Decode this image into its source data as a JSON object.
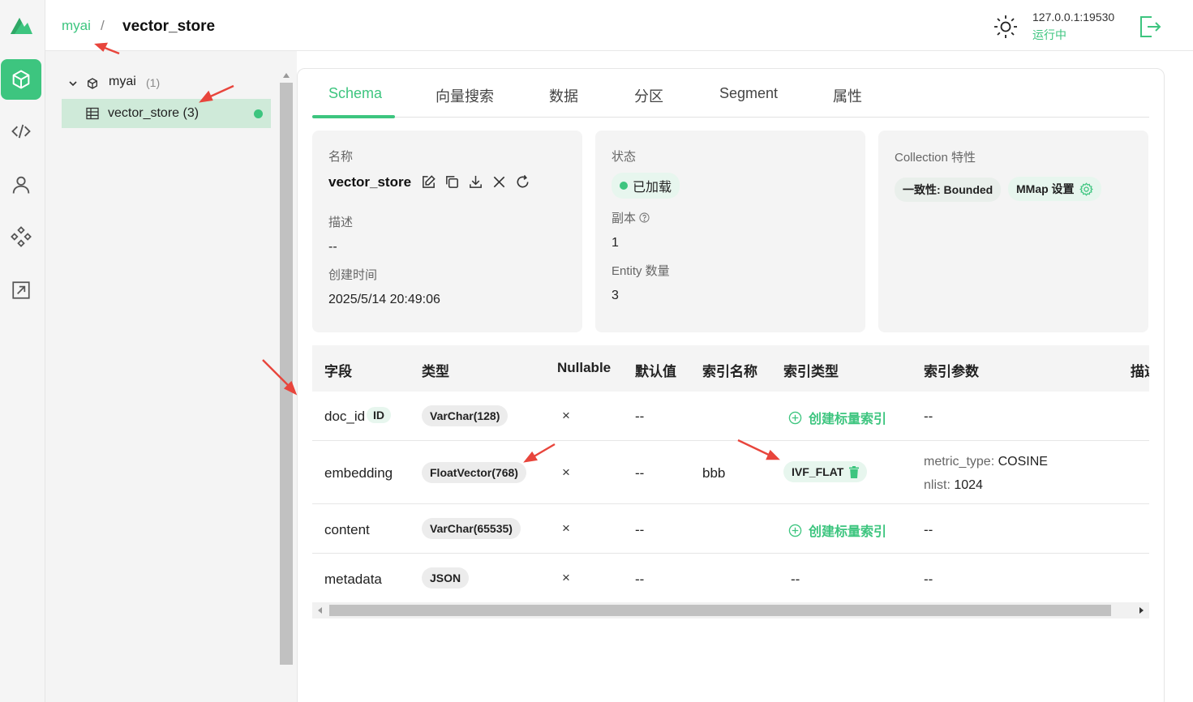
{
  "header": {
    "breadcrumb_root": "myai",
    "breadcrumb_sep": "/",
    "breadcrumb_current": "vector_store",
    "host": "127.0.0.1:19530",
    "host_status": "运行中"
  },
  "tree": {
    "database": {
      "label": "myai",
      "count": "(1)"
    },
    "collection": {
      "label": "vector_store (3)"
    }
  },
  "tabs": [
    "Schema",
    "向量搜索",
    "数据",
    "分区",
    "Segment",
    "属性"
  ],
  "info": {
    "name_key": "名称",
    "name_value": "vector_store",
    "desc_key": "描述",
    "desc_value": "--",
    "created_key": "创建时间",
    "created_value": "2025/5/14 20:49:06",
    "status_key": "状态",
    "status_value": "已加载",
    "replica_key": "副本",
    "replica_value": "1",
    "entity_key": "Entity 数量",
    "entity_value": "3",
    "features_key": "Collection 特性",
    "consistency": "一致性: Bounded",
    "mmap": "MMap 设置"
  },
  "table": {
    "headers": [
      "字段",
      "类型",
      "Nullable",
      "默认值",
      "索引名称",
      "索引类型",
      "索引参数",
      "描述"
    ],
    "rows": [
      {
        "field": "doc_id",
        "badge": "ID",
        "type": "VarChar(128)",
        "nullable": "×",
        "default": "--",
        "index_name": "",
        "index_action": "创建标量索引",
        "params": "--"
      },
      {
        "field": "embedding",
        "type": "FloatVector(768)",
        "nullable": "×",
        "default": "--",
        "index_name": "bbb",
        "index_type": "IVF_FLAT",
        "param1_key": "metric_type:",
        "param1_val": "COSINE",
        "param2_key": "nlist:",
        "param2_val": "1024"
      },
      {
        "field": "content",
        "type": "VarChar(65535)",
        "nullable": "×",
        "default": "--",
        "index_name": "",
        "index_action": "创建标量索引",
        "params": "--"
      },
      {
        "field": "metadata",
        "type": "JSON",
        "nullable": "×",
        "default": "--",
        "index_name": "",
        "index_type": "--",
        "params": "--"
      }
    ]
  },
  "colors": {
    "accent": "#3dc57f",
    "annotation": "#e8453c"
  }
}
